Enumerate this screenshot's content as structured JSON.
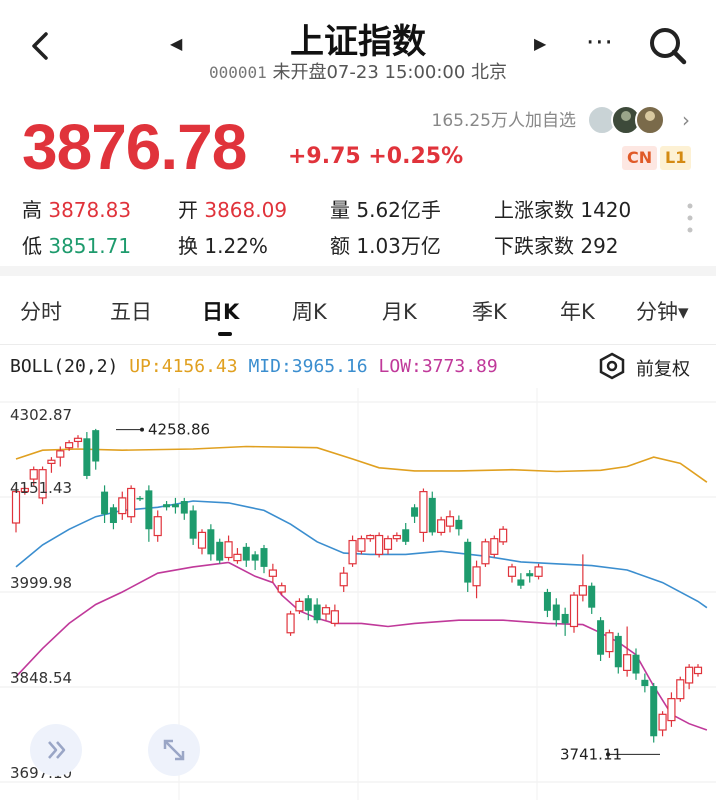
{
  "header": {
    "title": "上证指数",
    "code": "000001",
    "status": "未开盘07-23 15:00:00 北京",
    "prev_arrow": "◀",
    "next_arrow": "▶",
    "more": "···"
  },
  "quote": {
    "price": "3876.78",
    "change": "+9.75 +0.25%",
    "watch": "165.25万人加自选",
    "tag_cn": "CN",
    "tag_l1": "L1"
  },
  "stats": {
    "high_label": "高",
    "high": "3878.83",
    "open_label": "开",
    "open": "3868.09",
    "vol_label": "量",
    "vol": "5.62亿手",
    "up_label": "上涨家数",
    "up": "1420",
    "low_label": "低",
    "low": "3851.71",
    "turn_label": "换",
    "turn": "1.22%",
    "amt_label": "额",
    "amt": "1.03万亿",
    "down_label": "下跌家数",
    "down": "292"
  },
  "tabs": [
    "分时",
    "五日",
    "日K",
    "周K",
    "月K",
    "季K",
    "年K",
    "分钟▾"
  ],
  "active_tab": 2,
  "indicator": {
    "name": "BOLL(20,2)",
    "up": "UP:4156.43",
    "mid": "MID:3965.16",
    "low": "LOW:3773.89",
    "adjust": "前复权"
  },
  "colors": {
    "rise": "#e0333b",
    "fall": "#1e9b6d",
    "boll_up": "#e0a020",
    "boll_mid": "#3b8ecf",
    "boll_low": "#c0399a"
  },
  "chart_data": {
    "type": "candlestick",
    "y_ticks": [
      "4302.87",
      "4151.43",
      "3999.98",
      "3848.54",
      "3697.10"
    ],
    "ylim": [
      3697.1,
      4302.87
    ],
    "max_marker": "4258.86",
    "min_marker": "3741.11",
    "candles": [
      [
        4110,
        4160,
        4095,
        4165
      ],
      [
        4160,
        4165,
        4155,
        4168
      ],
      [
        4180,
        4195,
        4170,
        4200
      ],
      [
        4150,
        4195,
        4140,
        4200
      ],
      [
        4205,
        4210,
        4190,
        4215
      ],
      [
        4215,
        4225,
        4200,
        4232
      ],
      [
        4230,
        4238,
        4225,
        4242
      ],
      [
        4240,
        4245,
        4230,
        4250
      ],
      [
        4245,
        4185,
        4180,
        4255
      ],
      [
        4258,
        4208,
        4195,
        4260
      ],
      [
        4160,
        4124,
        4110,
        4170
      ],
      [
        4135,
        4110,
        4100,
        4140
      ],
      [
        4125,
        4150,
        4115,
        4160
      ],
      [
        4120,
        4165,
        4110,
        4170
      ],
      [
        4150,
        4148,
        4145,
        4153
      ],
      [
        4162,
        4100,
        4080,
        4170
      ],
      [
        4090,
        4120,
        4080,
        4130
      ],
      [
        4140,
        4135,
        4130,
        4145
      ],
      [
        4140,
        4135,
        4125,
        4150
      ],
      [
        4145,
        4125,
        4115,
        4150
      ],
      [
        4130,
        4085,
        4075,
        4138
      ],
      [
        4070,
        4095,
        4060,
        4100
      ],
      [
        4100,
        4060,
        4050,
        4108
      ],
      [
        4080,
        4050,
        4045,
        4085
      ],
      [
        4055,
        4080,
        4050,
        4090
      ],
      [
        4050,
        4060,
        4045,
        4070
      ],
      [
        4072,
        4050,
        4040,
        4078
      ],
      [
        4060,
        4050,
        4035,
        4065
      ],
      [
        4070,
        4040,
        4030,
        4075
      ],
      [
        4025,
        4035,
        4015,
        4045
      ],
      [
        4000,
        4010,
        3995,
        4015
      ],
      [
        3935,
        3965,
        3930,
        3970
      ],
      [
        3970,
        3985,
        3965,
        3990
      ],
      [
        3990,
        3970,
        3955,
        3995
      ],
      [
        3980,
        3955,
        3950,
        3990
      ],
      [
        3965,
        3975,
        3955,
        3980
      ],
      [
        3950,
        3970,
        3945,
        3980
      ],
      [
        4010,
        4030,
        4000,
        4040
      ],
      [
        4045,
        4082,
        4040,
        4090
      ],
      [
        4065,
        4085,
        4060,
        4090
      ],
      [
        4085,
        4090,
        4080,
        4092
      ],
      [
        4060,
        4090,
        4055,
        4095
      ],
      [
        4068,
        4085,
        4060,
        4090
      ],
      [
        4085,
        4090,
        4080,
        4095
      ],
      [
        4100,
        4080,
        4075,
        4110
      ],
      [
        4135,
        4120,
        4110,
        4140
      ],
      [
        4095,
        4160,
        4080,
        4165
      ],
      [
        4150,
        4095,
        4090,
        4160
      ],
      [
        4095,
        4115,
        4090,
        4120
      ],
      [
        4105,
        4120,
        4095,
        4130
      ],
      [
        4115,
        4100,
        4090,
        4122
      ],
      [
        4080,
        4015,
        4000,
        4085
      ],
      [
        4010,
        4040,
        3990,
        4050
      ],
      [
        4045,
        4080,
        4040,
        4085
      ],
      [
        4060,
        4085,
        4055,
        4090
      ],
      [
        4080,
        4100,
        4075,
        4105
      ],
      [
        4025,
        4040,
        4015,
        4045
      ],
      [
        4020,
        4010,
        4005,
        4030
      ],
      [
        4030,
        4025,
        4015,
        4035
      ],
      [
        4025,
        4040,
        4020,
        4045
      ],
      [
        4000,
        3970,
        3960,
        4005
      ],
      [
        3980,
        3955,
        3945,
        3990
      ],
      [
        3965,
        3950,
        3930,
        3975
      ],
      [
        3945,
        3995,
        3935,
        4000
      ],
      [
        3995,
        4010,
        3985,
        4060
      ],
      [
        4010,
        3975,
        3965,
        4015
      ],
      [
        3955,
        3900,
        3890,
        3960
      ],
      [
        3905,
        3935,
        3895,
        3940
      ],
      [
        3930,
        3880,
        3870,
        3935
      ],
      [
        3875,
        3900,
        3865,
        3945
      ],
      [
        3900,
        3870,
        3860,
        3910
      ],
      [
        3860,
        3850,
        3840,
        3870
      ],
      [
        3850,
        3770,
        3760,
        3855
      ],
      [
        3780,
        3805,
        3770,
        3810
      ],
      [
        3795,
        3830,
        3785,
        3840
      ],
      [
        3830,
        3860,
        3825,
        3865
      ],
      [
        3855,
        3880,
        3845,
        3885
      ],
      [
        3870,
        3880,
        3865,
        3885
      ]
    ],
    "boll_upper": [
      [
        0,
        4212
      ],
      [
        3,
        4226
      ],
      [
        7,
        4228
      ],
      [
        12,
        4226
      ],
      [
        20,
        4228
      ],
      [
        26,
        4232
      ],
      [
        34,
        4230
      ],
      [
        38,
        4212
      ],
      [
        41,
        4198
      ],
      [
        45,
        4193
      ],
      [
        50,
        4193
      ],
      [
        56,
        4195
      ],
      [
        61,
        4192
      ],
      [
        66,
        4194
      ],
      [
        69,
        4200
      ],
      [
        72,
        4215
      ],
      [
        75,
        4205
      ],
      [
        78,
        4175
      ]
    ],
    "boll_mid": [
      [
        0,
        4040
      ],
      [
        3,
        4075
      ],
      [
        6,
        4100
      ],
      [
        9,
        4120
      ],
      [
        12,
        4130
      ],
      [
        16,
        4135
      ],
      [
        20,
        4145
      ],
      [
        24,
        4142
      ],
      [
        28,
        4130
      ],
      [
        31,
        4108
      ],
      [
        34,
        4080
      ],
      [
        37,
        4062
      ],
      [
        40,
        4060
      ],
      [
        44,
        4060
      ],
      [
        48,
        4065
      ],
      [
        53,
        4057
      ],
      [
        57,
        4048
      ],
      [
        61,
        4045
      ],
      [
        65,
        4042
      ],
      [
        69,
        4035
      ],
      [
        73,
        4015
      ],
      [
        77,
        3985
      ],
      [
        78,
        3975
      ]
    ],
    "boll_lower": [
      [
        0,
        3865
      ],
      [
        3,
        3910
      ],
      [
        6,
        3950
      ],
      [
        9,
        3980
      ],
      [
        12,
        4000
      ],
      [
        16,
        4030
      ],
      [
        20,
        4040
      ],
      [
        24,
        4047
      ],
      [
        27,
        4025
      ],
      [
        29,
        4015
      ],
      [
        30,
        3995
      ],
      [
        32,
        3970
      ],
      [
        34,
        3958
      ],
      [
        36,
        3950
      ],
      [
        39,
        3950
      ],
      [
        42,
        3945
      ],
      [
        45,
        3950
      ],
      [
        50,
        3955
      ],
      [
        55,
        3955
      ],
      [
        60,
        3950
      ],
      [
        64,
        3948
      ],
      [
        66,
        3935
      ],
      [
        68,
        3920
      ],
      [
        70,
        3900
      ],
      [
        72,
        3850
      ],
      [
        74,
        3805
      ],
      [
        76,
        3790
      ],
      [
        78,
        3780
      ]
    ]
  }
}
